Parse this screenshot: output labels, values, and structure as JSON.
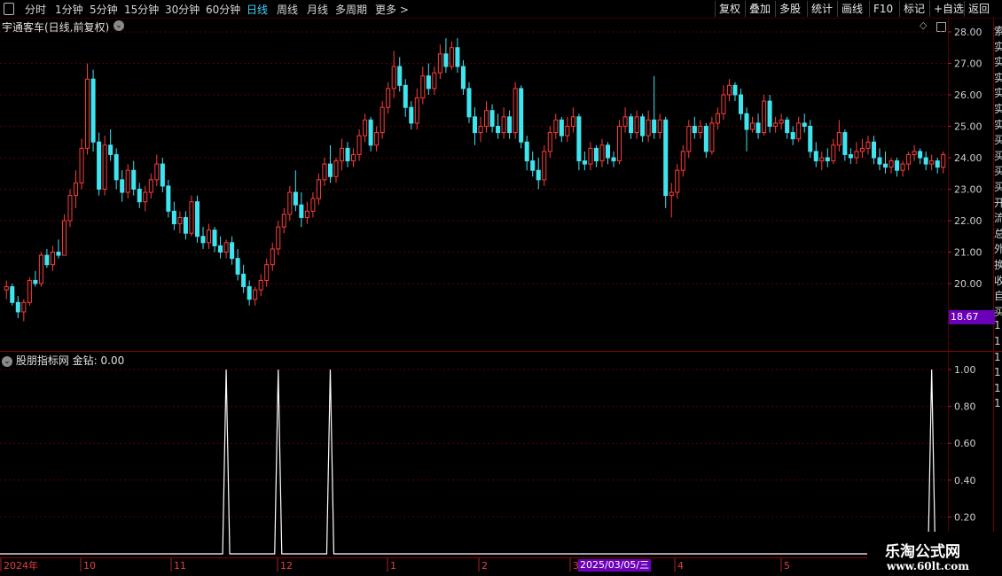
{
  "toolbar": {
    "periods": [
      "分时",
      "1分钟",
      "5分钟",
      "15分钟",
      "30分钟",
      "60分钟",
      "日线",
      "周线",
      "月线",
      "多周期",
      "更多 >"
    ],
    "active": "日线",
    "buttons": [
      "复权",
      "叠加",
      "多股",
      "统计",
      "画线",
      "F10",
      "标记",
      "+自选",
      "返回"
    ]
  },
  "main_chart": {
    "title": "宇通客车(日线,前复权)",
    "y_ticks": [
      "28.00",
      "27.00",
      "26.00",
      "25.00",
      "24.00",
      "23.00",
      "22.00",
      "21.00",
      "20.00"
    ],
    "low_marker": "18.67",
    "marker_color": "#7a00c8"
  },
  "indicator": {
    "title": "股朋指标网 金钻: 0.00",
    "y_ticks": [
      "1.00",
      "0.80",
      "0.60",
      "0.40",
      "0.20"
    ]
  },
  "date_axis": {
    "labels": [
      "2024年",
      "10",
      "11",
      "12",
      "1",
      "2",
      "3",
      "4",
      "5"
    ],
    "cursor_date": "2025/03/05/三"
  },
  "right_sidebar_glyphs": [
    "索",
    "实",
    "实",
    "实",
    "实",
    "实",
    "实",
    "买",
    "买",
    "买",
    "买",
    "开",
    "流",
    "总",
    "外",
    "换",
    "收",
    "自",
    "买",
    "1",
    "1",
    "1",
    "1",
    "1",
    "1"
  ],
  "watermark": {
    "name": "乐淘公式网",
    "url": "www.60lt.com"
  },
  "colors": {
    "up": "#ff3b3b",
    "down": "#3fe4ef",
    "grid": "#5a0000",
    "accent": "#3fd6ff"
  },
  "chart_data": {
    "type": "candlestick",
    "y_range": [
      18.67,
      28.0
    ],
    "candles": [
      [
        19.8,
        20.1,
        19.5,
        19.9
      ],
      [
        19.9,
        20.0,
        19.3,
        19.4
      ],
      [
        19.4,
        19.6,
        18.9,
        19.1
      ],
      [
        19.1,
        19.5,
        18.8,
        19.4
      ],
      [
        19.4,
        20.2,
        19.3,
        20.1
      ],
      [
        20.1,
        20.4,
        19.9,
        20.0
      ],
      [
        20.0,
        21.0,
        19.9,
        20.9
      ],
      [
        20.9,
        21.1,
        20.5,
        20.6
      ],
      [
        20.6,
        21.2,
        20.4,
        21.0
      ],
      [
        21.0,
        21.4,
        20.8,
        20.9
      ],
      [
        20.9,
        22.2,
        20.9,
        22.0
      ],
      [
        22.0,
        23.0,
        21.8,
        22.8
      ],
      [
        22.8,
        23.6,
        22.4,
        23.2
      ],
      [
        23.2,
        24.6,
        23.0,
        24.3
      ],
      [
        24.3,
        27.0,
        24.1,
        26.5
      ],
      [
        26.5,
        26.8,
        24.2,
        24.5
      ],
      [
        24.5,
        24.8,
        22.8,
        23.0
      ],
      [
        23.0,
        24.7,
        22.8,
        24.4
      ],
      [
        24.4,
        24.9,
        23.9,
        24.1
      ],
      [
        24.1,
        24.3,
        23.0,
        23.3
      ],
      [
        23.3,
        23.6,
        22.6,
        22.9
      ],
      [
        22.9,
        23.8,
        22.7,
        23.6
      ],
      [
        23.6,
        23.9,
        22.8,
        23.0
      ],
      [
        23.0,
        23.2,
        22.4,
        22.6
      ],
      [
        22.6,
        23.1,
        22.3,
        22.9
      ],
      [
        22.9,
        23.5,
        22.7,
        23.3
      ],
      [
        23.3,
        24.1,
        23.1,
        23.8
      ],
      [
        23.8,
        24.0,
        22.9,
        23.1
      ],
      [
        23.1,
        23.3,
        22.1,
        22.3
      ],
      [
        22.3,
        22.6,
        21.7,
        21.9
      ],
      [
        21.9,
        22.3,
        21.6,
        22.1
      ],
      [
        22.1,
        22.3,
        21.4,
        21.6
      ],
      [
        21.6,
        22.8,
        21.5,
        22.6
      ],
      [
        22.6,
        22.8,
        21.3,
        21.5
      ],
      [
        21.5,
        21.8,
        21.1,
        21.3
      ],
      [
        21.3,
        21.9,
        21.1,
        21.7
      ],
      [
        21.7,
        21.8,
        21.0,
        21.2
      ],
      [
        21.2,
        21.5,
        20.8,
        21.0
      ],
      [
        21.0,
        21.4,
        20.8,
        21.3
      ],
      [
        21.3,
        21.5,
        20.6,
        20.8
      ],
      [
        20.8,
        21.1,
        20.1,
        20.3
      ],
      [
        20.3,
        20.6,
        19.7,
        19.9
      ],
      [
        19.9,
        20.1,
        19.3,
        19.5
      ],
      [
        19.5,
        19.9,
        19.3,
        19.8
      ],
      [
        19.8,
        20.3,
        19.6,
        20.1
      ],
      [
        20.1,
        20.8,
        19.9,
        20.6
      ],
      [
        20.6,
        21.3,
        20.4,
        21.1
      ],
      [
        21.1,
        22.0,
        20.9,
        21.8
      ],
      [
        21.8,
        22.4,
        21.6,
        22.2
      ],
      [
        22.2,
        23.1,
        22.0,
        22.9
      ],
      [
        22.9,
        23.6,
        22.3,
        22.5
      ],
      [
        22.5,
        22.9,
        21.8,
        22.1
      ],
      [
        22.1,
        22.6,
        21.9,
        22.3
      ],
      [
        22.3,
        22.9,
        22.1,
        22.7
      ],
      [
        22.7,
        23.5,
        22.5,
        23.3
      ],
      [
        23.3,
        24.0,
        23.1,
        23.8
      ],
      [
        23.8,
        24.4,
        23.2,
        23.4
      ],
      [
        23.4,
        24.0,
        23.2,
        23.9
      ],
      [
        23.9,
        24.6,
        23.6,
        24.3
      ],
      [
        24.3,
        24.5,
        23.7,
        23.9
      ],
      [
        23.9,
        24.3,
        23.7,
        24.1
      ],
      [
        24.1,
        24.9,
        23.9,
        24.7
      ],
      [
        24.7,
        25.4,
        24.5,
        25.2
      ],
      [
        25.2,
        25.3,
        24.2,
        24.4
      ],
      [
        24.4,
        25.0,
        24.2,
        24.8
      ],
      [
        24.8,
        25.8,
        24.6,
        25.6
      ],
      [
        25.6,
        26.4,
        25.4,
        26.2
      ],
      [
        26.2,
        27.4,
        25.9,
        26.9
      ],
      [
        26.9,
        27.2,
        26.1,
        26.3
      ],
      [
        26.3,
        26.5,
        25.3,
        25.6
      ],
      [
        25.6,
        25.8,
        24.9,
        25.1
      ],
      [
        25.1,
        26.2,
        24.9,
        25.9
      ],
      [
        25.9,
        26.9,
        25.7,
        26.6
      ],
      [
        26.6,
        27.0,
        26.0,
        26.2
      ],
      [
        26.2,
        26.9,
        26.0,
        26.7
      ],
      [
        26.7,
        27.6,
        26.5,
        27.3
      ],
      [
        27.3,
        27.8,
        26.7,
        26.9
      ],
      [
        26.9,
        27.7,
        26.8,
        27.5
      ],
      [
        27.5,
        27.8,
        26.7,
        26.9
      ],
      [
        26.9,
        27.1,
        26.0,
        26.2
      ],
      [
        26.2,
        26.4,
        25.1,
        25.3
      ],
      [
        25.3,
        25.6,
        24.4,
        24.8
      ],
      [
        24.8,
        25.3,
        24.5,
        25.0
      ],
      [
        25.0,
        25.8,
        24.8,
        25.5
      ],
      [
        25.5,
        25.7,
        24.8,
        25.0
      ],
      [
        25.0,
        25.4,
        24.6,
        24.8
      ],
      [
        24.8,
        25.6,
        24.6,
        25.3
      ],
      [
        25.3,
        25.5,
        24.6,
        24.8
      ],
      [
        24.8,
        26.4,
        24.6,
        26.2
      ],
      [
        26.2,
        26.3,
        24.3,
        24.5
      ],
      [
        24.5,
        24.7,
        23.6,
        23.9
      ],
      [
        23.9,
        24.2,
        23.4,
        23.6
      ],
      [
        23.6,
        24.0,
        23.0,
        23.3
      ],
      [
        23.3,
        24.4,
        23.1,
        24.2
      ],
      [
        24.2,
        25.0,
        24.0,
        24.8
      ],
      [
        24.8,
        25.4,
        24.6,
        25.2
      ],
      [
        25.2,
        25.3,
        24.5,
        24.7
      ],
      [
        24.7,
        25.3,
        24.5,
        25.0
      ],
      [
        25.0,
        25.6,
        24.8,
        25.3
      ],
      [
        25.3,
        25.4,
        23.6,
        23.9
      ],
      [
        23.9,
        24.2,
        23.6,
        23.8
      ],
      [
        23.8,
        24.5,
        23.6,
        24.3
      ],
      [
        24.3,
        24.4,
        23.7,
        23.9
      ],
      [
        23.9,
        24.6,
        23.7,
        24.4
      ],
      [
        24.4,
        24.5,
        23.8,
        24.0
      ],
      [
        24.0,
        24.2,
        23.7,
        23.9
      ],
      [
        23.9,
        25.2,
        23.8,
        25.0
      ],
      [
        25.0,
        25.6,
        24.8,
        25.3
      ],
      [
        25.3,
        25.4,
        24.6,
        24.8
      ],
      [
        24.8,
        25.5,
        24.6,
        25.3
      ],
      [
        25.3,
        25.4,
        24.5,
        24.7
      ],
      [
        24.7,
        25.5,
        24.5,
        25.2
      ],
      [
        25.2,
        26.6,
        24.6,
        24.8
      ],
      [
        24.8,
        25.4,
        24.6,
        25.2
      ],
      [
        25.2,
        25.3,
        22.4,
        22.8
      ],
      [
        22.8,
        23.2,
        22.1,
        22.9
      ],
      [
        22.9,
        23.8,
        22.7,
        23.6
      ],
      [
        23.6,
        24.4,
        23.4,
        24.2
      ],
      [
        24.2,
        25.2,
        24.0,
        25.0
      ],
      [
        25.0,
        25.3,
        24.6,
        24.8
      ],
      [
        24.8,
        25.2,
        24.6,
        25.0
      ],
      [
        25.0,
        25.1,
        24.0,
        24.2
      ],
      [
        24.2,
        25.3,
        24.1,
        25.1
      ],
      [
        25.1,
        25.6,
        24.9,
        25.4
      ],
      [
        25.4,
        26.3,
        25.2,
        26.0
      ],
      [
        26.0,
        26.5,
        25.8,
        26.3
      ],
      [
        26.3,
        26.4,
        25.8,
        26.0
      ],
      [
        26.0,
        26.2,
        25.2,
        25.4
      ],
      [
        25.4,
        25.6,
        24.2,
        24.9
      ],
      [
        24.9,
        25.3,
        24.8,
        25.1
      ],
      [
        25.1,
        25.4,
        24.6,
        24.8
      ],
      [
        24.8,
        26.0,
        24.7,
        25.8
      ],
      [
        25.8,
        26.0,
        24.8,
        25.0
      ],
      [
        25.0,
        25.3,
        24.8,
        25.1
      ],
      [
        25.1,
        25.4,
        24.9,
        25.2
      ],
      [
        25.2,
        25.3,
        24.6,
        24.8
      ],
      [
        24.8,
        25.0,
        24.4,
        24.6
      ],
      [
        24.6,
        25.3,
        24.5,
        25.1
      ],
      [
        25.1,
        25.4,
        24.8,
        25.0
      ],
      [
        25.0,
        25.2,
        24.0,
        24.2
      ],
      [
        24.2,
        24.5,
        23.7,
        23.9
      ],
      [
        23.9,
        24.2,
        23.6,
        24.0
      ],
      [
        24.0,
        24.3,
        23.7,
        23.9
      ],
      [
        23.9,
        24.6,
        23.8,
        24.4
      ],
      [
        24.4,
        25.2,
        24.2,
        24.8
      ],
      [
        24.8,
        24.9,
        23.9,
        24.1
      ],
      [
        24.1,
        24.3,
        23.8,
        24.0
      ],
      [
        24.0,
        24.5,
        23.8,
        24.2
      ],
      [
        24.2,
        24.6,
        24.0,
        24.3
      ],
      [
        24.3,
        24.7,
        24.1,
        24.5
      ],
      [
        24.5,
        24.7,
        23.8,
        24.0
      ],
      [
        24.0,
        24.3,
        23.6,
        23.8
      ],
      [
        23.8,
        24.2,
        23.5,
        23.7
      ],
      [
        23.7,
        24.0,
        23.5,
        23.9
      ],
      [
        23.9,
        24.0,
        23.4,
        23.6
      ],
      [
        23.6,
        23.9,
        23.4,
        23.8
      ],
      [
        23.8,
        24.2,
        23.6,
        24.1
      ],
      [
        24.1,
        24.4,
        23.9,
        24.2
      ],
      [
        24.2,
        24.3,
        23.8,
        24.0
      ],
      [
        24.0,
        24.2,
        23.6,
        23.8
      ],
      [
        23.8,
        24.1,
        23.6,
        23.9
      ],
      [
        23.9,
        24.0,
        23.5,
        23.7
      ],
      [
        23.7,
        24.2,
        23.5,
        24.1
      ]
    ],
    "indicator_series": {
      "name": "金钻",
      "spikes_at_candle_index": [
        38,
        47,
        56,
        160
      ],
      "value_range": [
        0,
        1
      ]
    }
  }
}
